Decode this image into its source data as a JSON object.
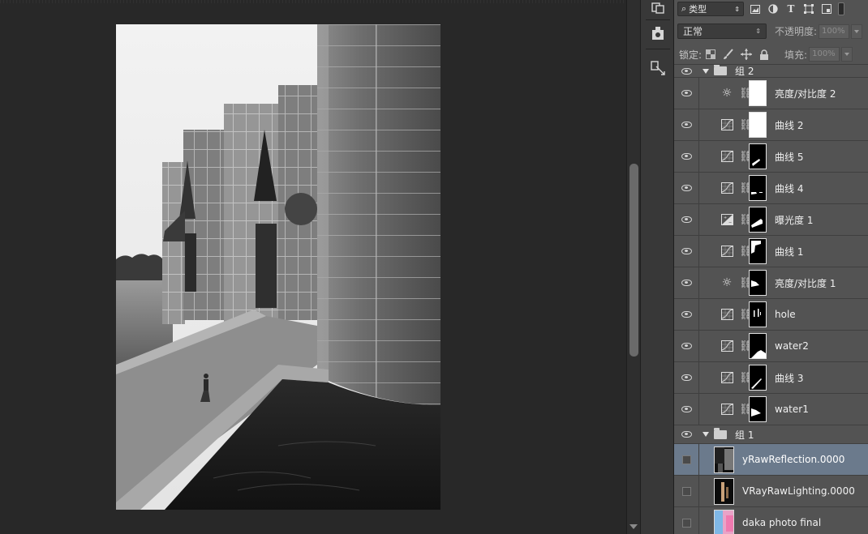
{
  "layers_panel": {
    "filter_label": "类型",
    "blend_mode": "正常",
    "opacity_label": "不透明度:",
    "opacity_value": "100%",
    "lock_label": "锁定:",
    "fill_label": "填充:",
    "fill_value": "100%",
    "layers": [
      {
        "kind": "group",
        "name": "组 2",
        "visible": true
      },
      {
        "kind": "adjust",
        "icon": "brightness-contrast-icon",
        "name": "亮度/对比度 2",
        "visible": true,
        "mask": "white"
      },
      {
        "kind": "adjust",
        "icon": "curves-icon",
        "name": "曲线 2",
        "visible": true,
        "mask": "white"
      },
      {
        "kind": "adjust",
        "icon": "curves-icon",
        "name": "曲线 5",
        "visible": true,
        "mask": "black"
      },
      {
        "kind": "adjust",
        "icon": "curves-icon",
        "name": "曲线 4",
        "visible": true,
        "mask": "black"
      },
      {
        "kind": "adjust",
        "icon": "exposure-icon",
        "name": "曝光度 1",
        "visible": true,
        "mask": "black"
      },
      {
        "kind": "adjust",
        "icon": "curves-icon",
        "name": "曲线 1",
        "visible": true,
        "mask": "black"
      },
      {
        "kind": "adjust",
        "icon": "brightness-contrast-icon",
        "name": "亮度/对比度 1",
        "visible": true,
        "mask": "black"
      },
      {
        "kind": "adjust",
        "icon": "curves-icon",
        "name": "hole",
        "visible": true,
        "mask": "black"
      },
      {
        "kind": "adjust",
        "icon": "curves-icon",
        "name": "water2",
        "visible": true,
        "mask": "black"
      },
      {
        "kind": "adjust",
        "icon": "curves-icon",
        "name": "曲线 3",
        "visible": true,
        "mask": "black"
      },
      {
        "kind": "adjust",
        "icon": "curves-icon",
        "name": "water1",
        "visible": true,
        "mask": "black"
      },
      {
        "kind": "group",
        "name": "组 1",
        "visible": true
      },
      {
        "kind": "pixel",
        "name": "yRawReflection.0000",
        "visible": false,
        "selected": true
      },
      {
        "kind": "pixel",
        "name": "VRayRawLighting.0000",
        "visible": false
      },
      {
        "kind": "pixel",
        "name": "daka photo final",
        "visible": false
      }
    ]
  },
  "colors": {
    "panel_bg": "#535353",
    "canvas_bg": "#282828",
    "selected_row": "#6b7a8c"
  }
}
